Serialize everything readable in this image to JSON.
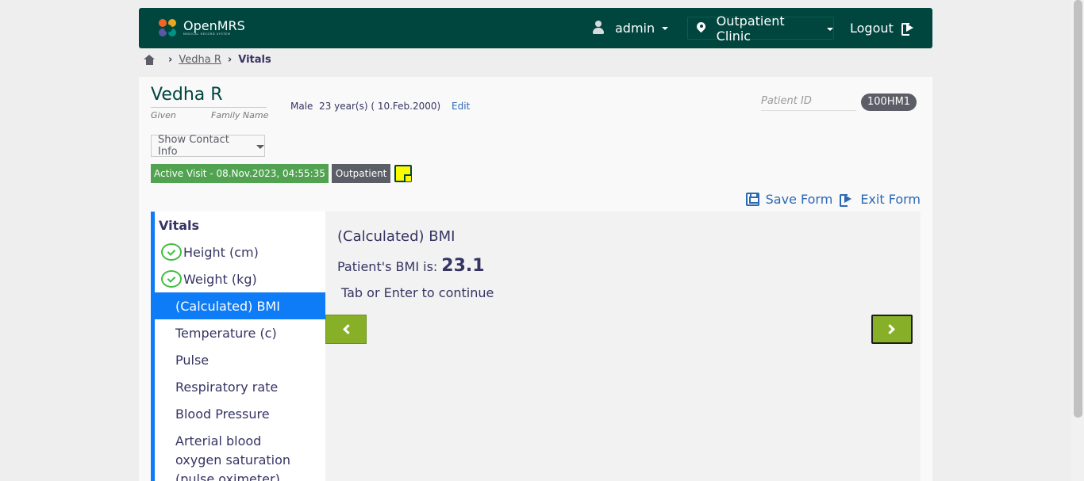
{
  "header": {
    "logo_text": "OpenMRS",
    "logo_subtext": "MEDICAL RECORD SYSTEM",
    "user": "admin",
    "location": "Outpatient Clinic",
    "logout": "Logout"
  },
  "breadcrumb": {
    "patient": "Vedha R",
    "current": "Vitals",
    "separator": "›"
  },
  "patient": {
    "name": "Vedha R",
    "given_label": "Given",
    "family_label": "Family Name",
    "demographics": "Male  23 year(s) ( 10.Feb.2000)",
    "edit": "Edit",
    "id_label": "Patient ID",
    "id": "100HM1",
    "contact_button": "Show Contact Info",
    "visit_badge": "Active Visit - 08.Nov.2023, 04:55:35",
    "visit_type": "Outpatient"
  },
  "form": {
    "save": "Save Form",
    "exit": "Exit Form",
    "sidebar_title": "Vitals",
    "sidebar_items": [
      {
        "label": "Height (cm)"
      },
      {
        "label": "Weight (kg)"
      },
      {
        "label": "(Calculated) BMI"
      },
      {
        "label": "Temperature (c)"
      },
      {
        "label": "Pulse"
      },
      {
        "label": "Respiratory rate"
      },
      {
        "label": "Blood Pressure"
      },
      {
        "label": "Arterial blood oxygen saturation (pulse oximeter)"
      }
    ],
    "question_title": "(Calculated) BMI",
    "bmi_label": "Patient's BMI is:",
    "bmi_value": "23.1",
    "hint": "Tab or Enter to continue"
  },
  "colors": {
    "header_bg": "#00463f",
    "accent_blue": "#0e7bf7",
    "link_blue": "#2c69b3",
    "nav_green": "#88af28",
    "visit_green": "#51a351",
    "check_green": "#3fbd3f"
  }
}
